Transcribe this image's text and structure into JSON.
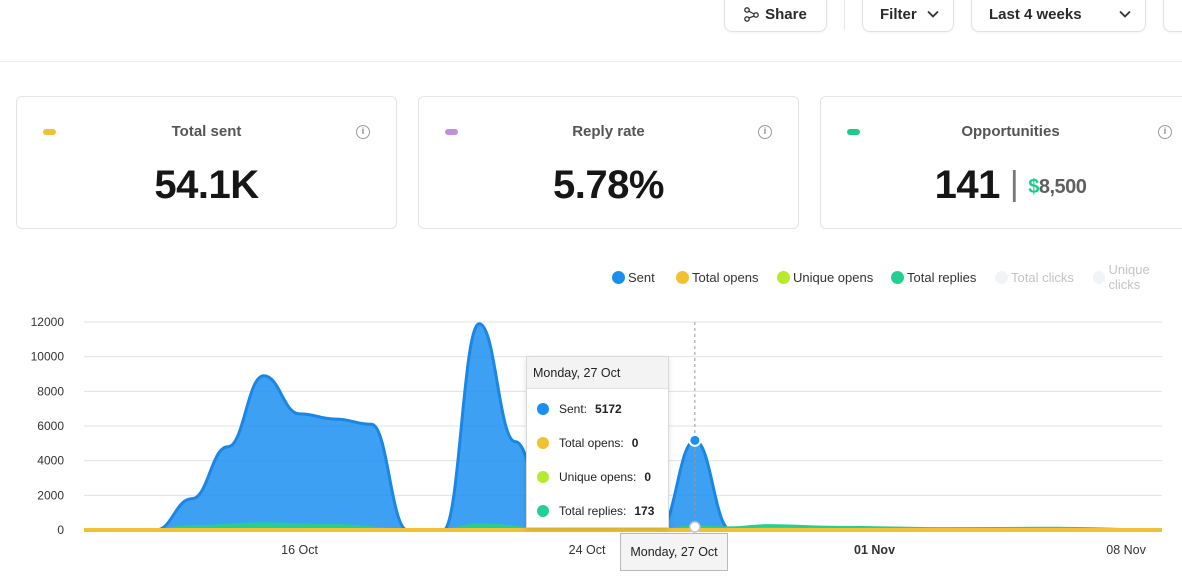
{
  "toolbar": {
    "share_label": "Share",
    "filter_label": "Filter",
    "range_label": "Last 4 weeks"
  },
  "cards": [
    {
      "title": "Total sent",
      "value": "54.1K",
      "color": "#f0c233"
    },
    {
      "title": "Reply rate",
      "value": "5.78%",
      "color": "#c48ee0"
    },
    {
      "title": "Opportunities",
      "value": "141",
      "sep": "|",
      "currency": "$",
      "amount": "8,500",
      "color": "#1fc98a"
    }
  ],
  "legend": [
    {
      "label": "Sent",
      "color": "#1b8ff0",
      "active": true
    },
    {
      "label": "Total opens",
      "color": "#f0c233",
      "active": true
    },
    {
      "label": "Unique opens",
      "color": "#b6ea2c",
      "active": true
    },
    {
      "label": "Total replies",
      "color": "#22d192",
      "active": true
    },
    {
      "label": "Total clicks",
      "color": "#f1f4f7",
      "active": false
    },
    {
      "label": "Unique clicks",
      "color": "#f1f4f7",
      "active": false
    }
  ],
  "tooltip": {
    "date": "Monday, 27 Oct",
    "rows": [
      {
        "label": "Sent:",
        "value": "5172",
        "color": "#1b8ff0"
      },
      {
        "label": "Total opens:",
        "value": "0",
        "color": "#f0c233"
      },
      {
        "label": "Unique opens:",
        "value": "0",
        "color": "#b6ea2c"
      },
      {
        "label": "Total replies:",
        "value": "173",
        "color": "#22d192"
      }
    ]
  },
  "hover_x_label": "Monday, 27 Oct",
  "chart_data": {
    "type": "area",
    "yticks": [
      "0",
      "2000",
      "4000",
      "6000",
      "8000",
      "10000",
      "12000"
    ],
    "ylim": [
      0,
      12000
    ],
    "xticks": [
      {
        "label": "16 Oct",
        "date": "2025-10-16",
        "bold": false
      },
      {
        "label": "24 Oct",
        "date": "2025-10-24",
        "bold": false
      },
      {
        "label": "01 Nov",
        "date": "2025-11-01",
        "bold": true
      },
      {
        "label": "08 Nov",
        "date": "2025-11-08",
        "bold": false
      }
    ],
    "xlim": [
      "2025-10-10",
      "2025-11-09"
    ],
    "grid": true,
    "series": [
      {
        "name": "Sent",
        "color": "#1b8ff0",
        "points": [
          [
            "2025-10-10",
            0
          ],
          [
            "2025-10-12",
            0
          ],
          [
            "2025-10-13",
            1800
          ],
          [
            "2025-10-14",
            4800
          ],
          [
            "2025-10-15",
            8900
          ],
          [
            "2025-10-16",
            6700
          ],
          [
            "2025-10-17",
            6400
          ],
          [
            "2025-10-18",
            6100
          ],
          [
            "2025-10-19",
            0
          ],
          [
            "2025-10-20",
            0
          ],
          [
            "2025-10-21",
            11900
          ],
          [
            "2025-10-22",
            5100
          ],
          [
            "2025-10-23",
            0
          ],
          [
            "2025-10-24",
            0
          ],
          [
            "2025-10-26",
            0
          ],
          [
            "2025-10-27",
            5172
          ],
          [
            "2025-10-28",
            0
          ],
          [
            "2025-11-09",
            0
          ]
        ]
      },
      {
        "name": "Total replies",
        "color": "#22d192",
        "points": [
          [
            "2025-10-10",
            0
          ],
          [
            "2025-10-12",
            0
          ],
          [
            "2025-10-13",
            200
          ],
          [
            "2025-10-15",
            350
          ],
          [
            "2025-10-17",
            250
          ],
          [
            "2025-10-19",
            0
          ],
          [
            "2025-10-20",
            0
          ],
          [
            "2025-10-21",
            300
          ],
          [
            "2025-10-23",
            0
          ],
          [
            "2025-10-26",
            0
          ],
          [
            "2025-10-27",
            173
          ],
          [
            "2025-10-28",
            120
          ],
          [
            "2025-10-29",
            250
          ],
          [
            "2025-10-31",
            150
          ],
          [
            "2025-11-03",
            80
          ],
          [
            "2025-11-06",
            100
          ],
          [
            "2025-11-09",
            0
          ]
        ]
      },
      {
        "name": "Total opens",
        "color": "#f0c233",
        "points": [
          [
            "2025-10-10",
            0
          ],
          [
            "2025-11-09",
            0
          ]
        ]
      }
    ]
  }
}
